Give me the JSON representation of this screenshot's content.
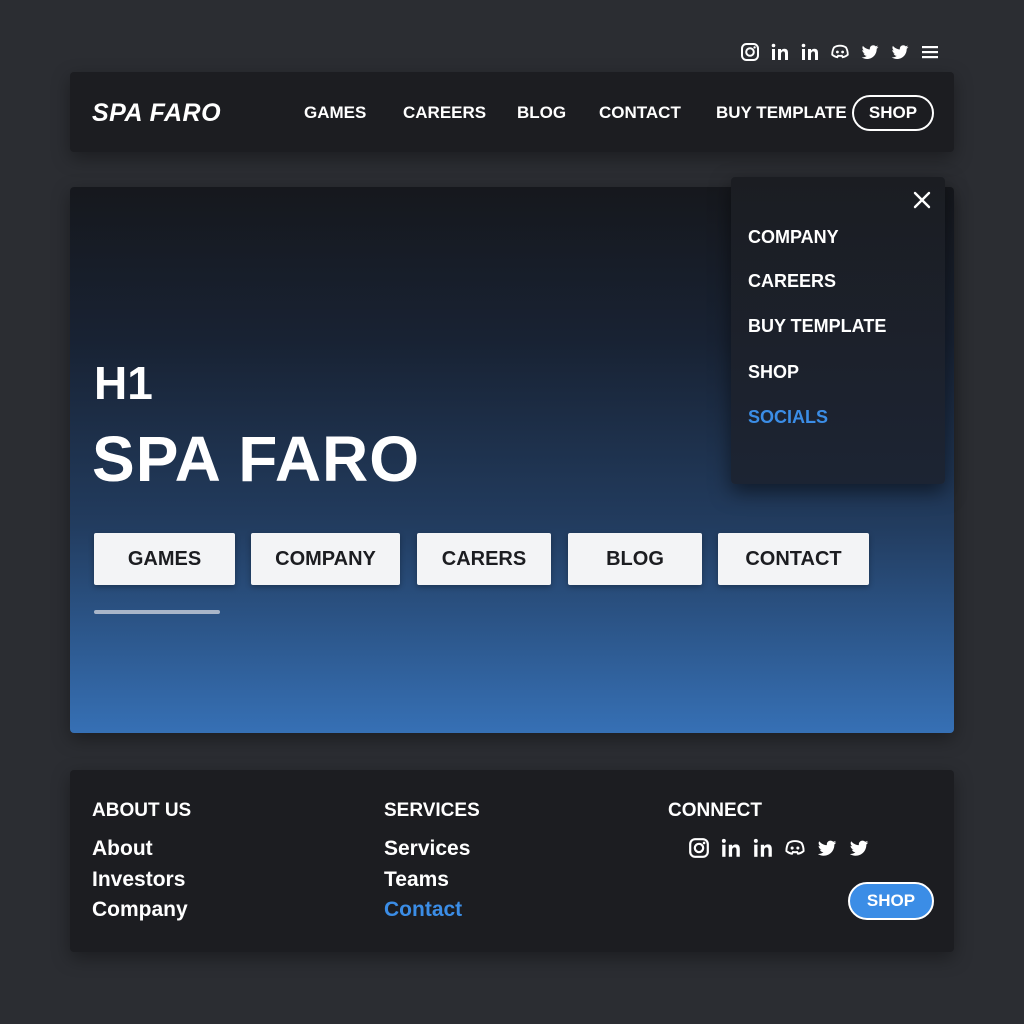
{
  "top_socials": [
    {
      "icon": "instagram-icon"
    },
    {
      "icon": "linkedin-icon"
    },
    {
      "icon": "linkedin-icon"
    },
    {
      "icon": "discord-icon"
    },
    {
      "icon": "twitter-icon"
    },
    {
      "icon": "twitter-icon"
    },
    {
      "icon": "menu-icon"
    }
  ],
  "header": {
    "logo": "SPA FARO",
    "nav": [
      "GAMES",
      "CAREERS",
      "BLOG",
      "CONTACT",
      "BUY TEMPLATE"
    ],
    "shop_label": "SHOP"
  },
  "hero": {
    "h1_label": "H1",
    "title": "SPA FARO",
    "buttons": [
      "GAMES",
      "COMPANY",
      "CARERS",
      "BLOG",
      "CONTACT"
    ]
  },
  "dropdown": {
    "items": [
      "COMPANY",
      "CAREERS",
      "BUY TEMPLATE",
      "SHOP",
      "SOCIALS"
    ],
    "accent_item": "SOCIALS"
  },
  "footer": {
    "about": {
      "heading": "ABOUT US",
      "links": [
        "About",
        "Investors",
        "Company"
      ]
    },
    "services": {
      "heading": "SERVICES",
      "links": [
        "Services",
        "Teams",
        "Contact"
      ]
    },
    "connect": {
      "heading": "CONNECT",
      "shop_label": "SHOP"
    },
    "socials": [
      {
        "icon": "instagram-icon"
      },
      {
        "icon": "linkedin-icon"
      },
      {
        "icon": "linkedin-icon"
      },
      {
        "icon": "discord-icon"
      },
      {
        "icon": "twitter-icon"
      },
      {
        "icon": "twitter-icon"
      }
    ]
  },
  "colors": {
    "background": "#2b2d32",
    "panel": "#1c1d21",
    "accent": "#3b8de6",
    "hero_gradient_bottom": "#3670b5"
  }
}
